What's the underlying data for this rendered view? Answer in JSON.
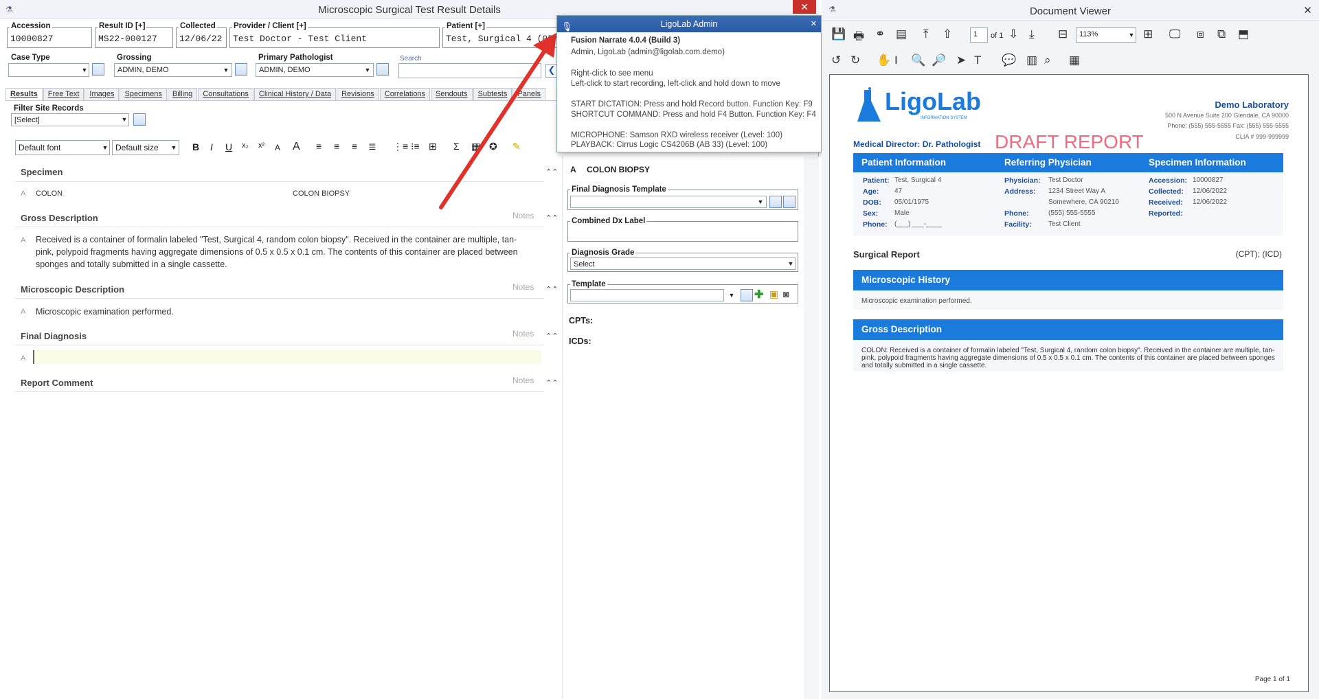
{
  "left_window": {
    "title": "Microscopic Surgical Test Result Details",
    "close": "✕",
    "fields": {
      "accession": {
        "label": "Accession",
        "value": "10000827"
      },
      "result_id": {
        "label": "Result ID [+]",
        "value": "MS22-000127"
      },
      "collected": {
        "label": "Collected",
        "value": "12/06/22"
      },
      "provider": {
        "label": "Provider / Client [+]",
        "value": "Test Doctor - Test Client"
      },
      "patient": {
        "label": "Patient [+]",
        "value": "Test, Surgical 4 (05/01/197"
      },
      "case_type": {
        "label": "Case Type",
        "value": ""
      },
      "grossing": {
        "label": "Grossing",
        "value": "ADMIN, DEMO"
      },
      "primary_pathologist": {
        "label": "Primary Pathologist",
        "value": "ADMIN, DEMO"
      },
      "search": {
        "label": "Search",
        "value": ""
      }
    },
    "tabs": [
      "Results",
      "Free Text",
      "Images",
      "Specimens",
      "Billing",
      "Consultations",
      "Clinical History / Data",
      "Revisions",
      "Correlations",
      "Sendouts",
      "Subtests",
      "Panels"
    ],
    "filter": {
      "label": "Filter Site Records",
      "value": "[Select]"
    },
    "editor": {
      "font": "Default font",
      "size": "Default size"
    },
    "sections": {
      "specimen": {
        "title": "Specimen",
        "marker": "A",
        "name": "COLON",
        "desc": "COLON BIOPSY"
      },
      "gross": {
        "title": "Gross Description",
        "notes": "Notes",
        "marker": "A",
        "text": "Received is a container of formalin labeled \"Test, Surgical 4, random colon biopsy\". Received in the container are multiple, tan-pink, polypoid fragments having aggregate dimensions of 0.5 x 0.5 x 0.1 cm. The contents of this container are placed between sponges and totally submitted in a single cassette."
      },
      "micro": {
        "title": "Microscopic Description",
        "notes": "Notes",
        "marker": "A",
        "text": "Microscopic examination performed."
      },
      "final": {
        "title": "Final Diagnosis",
        "notes": "Notes",
        "marker": "A"
      },
      "comment": {
        "title": "Report Comment",
        "notes": "Notes"
      }
    },
    "right": {
      "specimen_marker": "A",
      "specimen_title": "COLON BIOPSY",
      "final_dx_template": "Final Diagnosis Template",
      "combined_dx": "Combined Dx Label",
      "grade": {
        "label": "Diagnosis Grade",
        "value": "Select"
      },
      "template": "Template",
      "cpts": "CPTs:",
      "icds": "ICDs:"
    }
  },
  "popup": {
    "title": "LigoLab Admin",
    "close": "✕",
    "lines": [
      "Fusion Narrate 4.0.4 (Build 3)",
      "Admin, LigoLab (admin@ligolab.com.demo)",
      "Right-click to see menu",
      "Left-click to start recording, left-click and hold down to move",
      "START DICTATION: Press and hold Record button. Function Key: F9",
      "SHORTCUT COMMAND: Press and hold F4 Button. Function Key: F4",
      "MICROPHONE: Samson RXD wireless receiver (Level: 100)",
      "PLAYBACK: Cirrus Logic CS4206B (AB 33) (Level: 100)"
    ]
  },
  "viewer": {
    "title": "Document Viewer",
    "close": "✕",
    "page_input": "1",
    "page_of": "of 1",
    "zoom": "113%",
    "doc": {
      "logo": "LigoLab",
      "logo_sub": "INFORMATION SYSTEM",
      "lab_name": "Demo Laboratory",
      "lab_addr": "500 N Avenue Suite 200  Glendale, CA 90000",
      "lab_phone": "Phone: (555) 555-5555   Fax: (555) 555-5555",
      "clia": "CLIA # 999-999999",
      "medical_director": "Medical Director: Dr. Pathologist",
      "draft": "DRAFT REPORT",
      "headers": [
        "Patient Information",
        "Referring Physician",
        "Specimen Information"
      ],
      "patient": [
        [
          "Patient:",
          "Test, Surgical 4"
        ],
        [
          "Age:",
          "47"
        ],
        [
          "DOB:",
          "05/01/1975"
        ],
        [
          "Sex:",
          "Male"
        ],
        [
          "Phone:",
          "(___) ___-____"
        ]
      ],
      "physician": [
        [
          "Physician:",
          "Test Doctor"
        ],
        [
          "Address:",
          "1234 Street Way A"
        ],
        [
          "",
          "Somewhere, CA 90210"
        ],
        [
          "Phone:",
          "(555) 555-5555"
        ],
        [
          "Facility:",
          "Test Client"
        ]
      ],
      "specimen": [
        [
          "Accession:",
          "10000827"
        ],
        [
          "Collected:",
          "12/06/2022"
        ],
        [
          "Received:",
          "12/06/2022"
        ],
        [
          "Reported:",
          ""
        ]
      ],
      "surgical_report": "Surgical Report",
      "cpt_icd": "(CPT); (ICD)",
      "micro_history": "Microscopic History",
      "micro_text": "Microscopic examination performed.",
      "gross": "Gross Description",
      "gross_text": "COLON: Received is a container of formalin labeled \"Test, Surgical 4, random colon biopsy\". Received in the container are multiple, tan-pink, polypoid fragments having aggregate dimensions of 0.5 x 0.5 x 0.1 cm. The contents of this container are placed between sponges and totally submitted in a single cassette.",
      "page": "Page 1 of 1"
    }
  }
}
